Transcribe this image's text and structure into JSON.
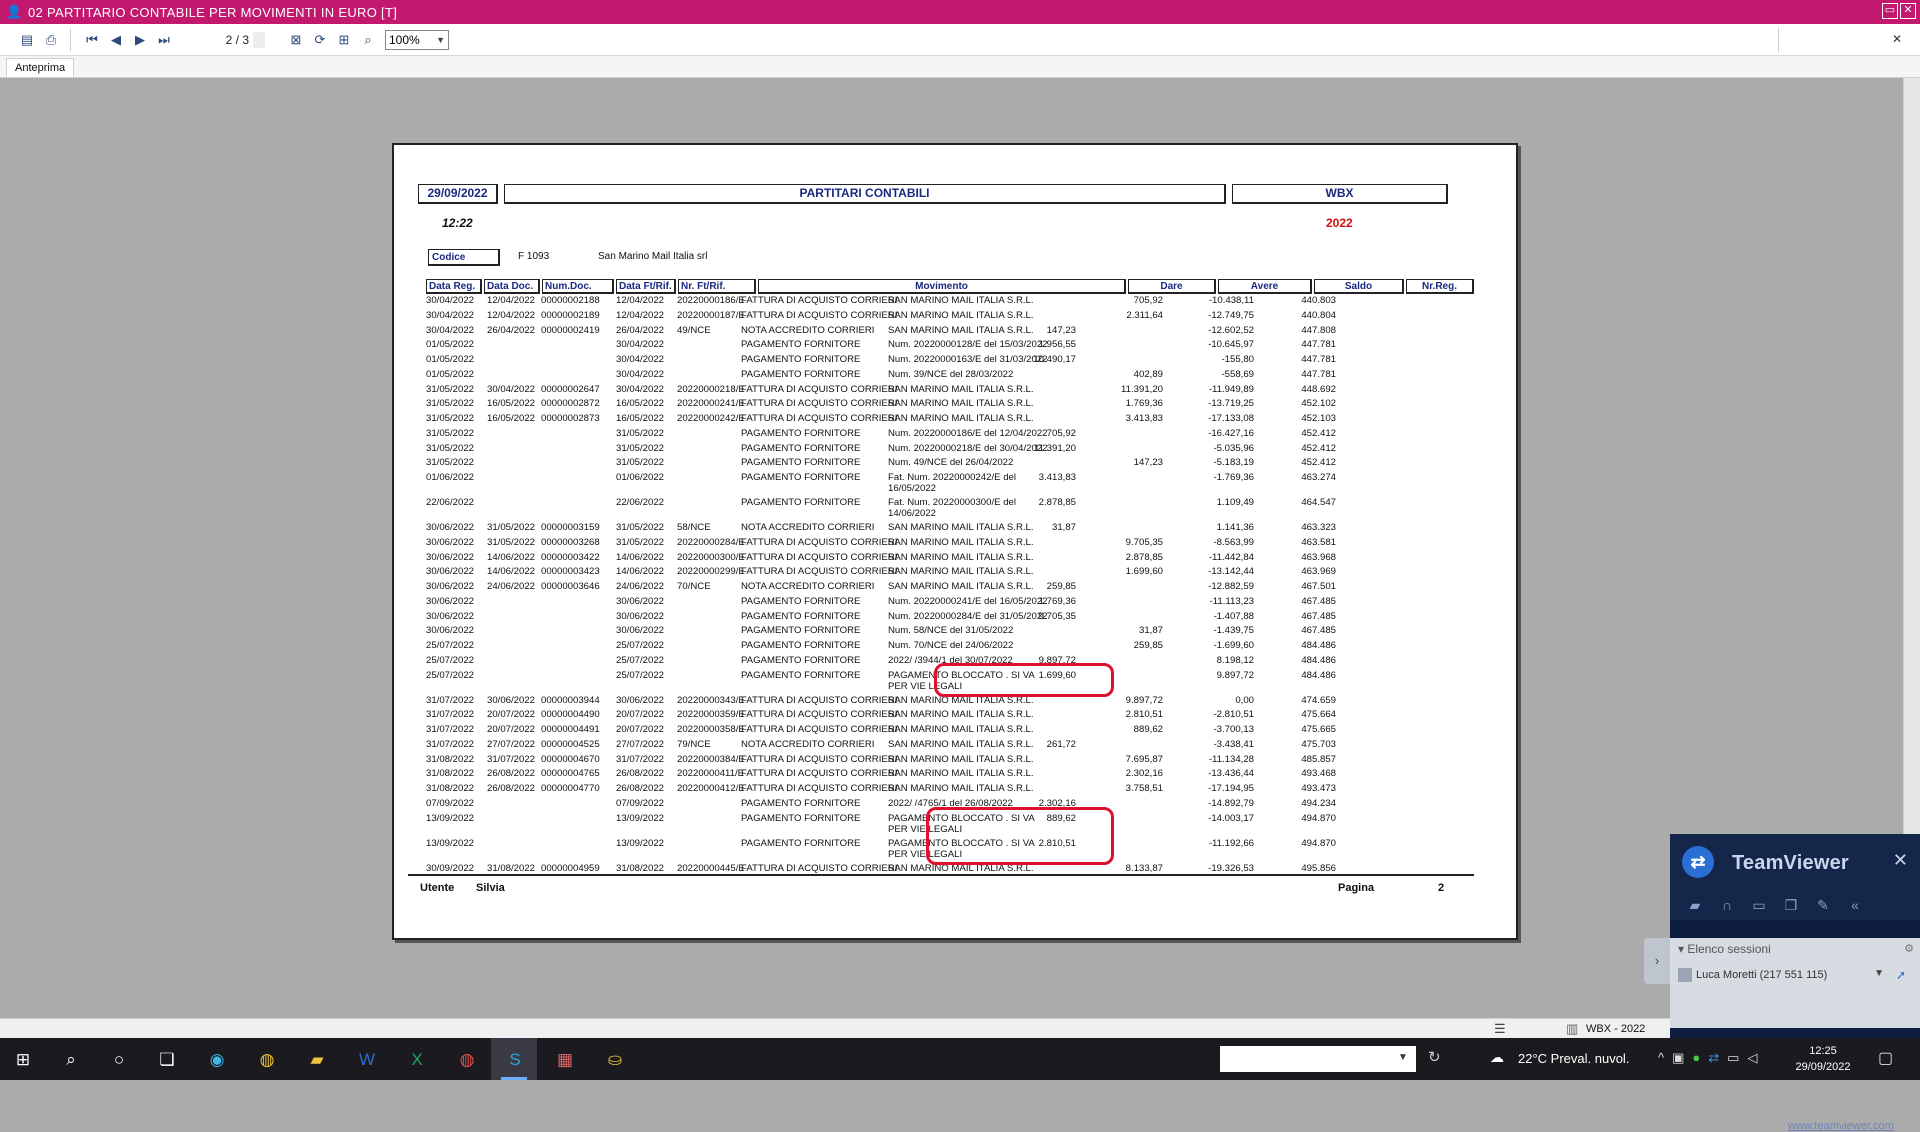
{
  "window": {
    "title": "02  PARTITARIO CONTABILE PER MOVIMENTI IN EURO [T]",
    "title_icon": "user-icon",
    "minimize": "▭",
    "close": "✕"
  },
  "toolbar": {
    "page_indicator": "2 / 3",
    "zoom": "100%",
    "icons": [
      "export-icon",
      "print-icon",
      "first-page-icon",
      "prev-page-icon",
      "next-page-icon",
      "last-page-icon",
      "close-preview-icon",
      "refresh-icon",
      "page-setup-icon",
      "find-icon"
    ],
    "close": "✕"
  },
  "tabs": {
    "preview": "Anteprima"
  },
  "report": {
    "date": "29/09/2022",
    "title": "PARTITARI CONTABILI",
    "company": "WBX",
    "time": "12:22",
    "year": "2022",
    "codice_label": "Codice",
    "codice_value": "F  1093",
    "codice_name": "San Marino Mail Italia srl",
    "columns": {
      "data_reg": "Data Reg.",
      "data_doc": "Data Doc.",
      "num_doc": "Num.Doc.",
      "data_ft": "Data Ft/Rif.",
      "nr_ft": "Nr. Ft/Rif.",
      "movimento": "Movimento",
      "dare": "Dare",
      "avere": "Avere",
      "saldo": "Saldo",
      "nr_reg": "Nr.Reg."
    },
    "rows": [
      {
        "dreg": "30/04/2022",
        "ddoc": "12/04/2022",
        "ndoc": "00000002188",
        "dft": "12/04/2022",
        "nft": "20220000186/E",
        "cau": "FATTURA DI ACQUISTO CORRIERI",
        "desc": "SAN MARINO MAIL ITALIA S.R.L.",
        "dare": "",
        "avere": "705,92",
        "saldo": "-10.438,11",
        "nreg": "440.803"
      },
      {
        "dreg": "30/04/2022",
        "ddoc": "12/04/2022",
        "ndoc": "00000002189",
        "dft": "12/04/2022",
        "nft": "20220000187/E",
        "cau": "FATTURA DI ACQUISTO CORRIERI",
        "desc": "SAN MARINO MAIL ITALIA S.R.L.",
        "dare": "",
        "avere": "2.311,64",
        "saldo": "-12.749,75",
        "nreg": "440.804"
      },
      {
        "dreg": "30/04/2022",
        "ddoc": "26/04/2022",
        "ndoc": "00000002419",
        "dft": "26/04/2022",
        "nft": "49/NCE",
        "cau": "NOTA ACCREDITO CORRIERI",
        "desc": "SAN MARINO MAIL ITALIA S.R.L.",
        "dare": "147,23",
        "avere": "",
        "saldo": "-12.602,52",
        "nreg": "447.808"
      },
      {
        "dreg": "01/05/2022",
        "ddoc": "",
        "ndoc": "",
        "dft": "30/04/2022",
        "nft": "",
        "cau": "PAGAMENTO FORNITORE",
        "desc": "Num. 20220000128/E del 15/03/2022",
        "dare": "1.956,55",
        "avere": "",
        "saldo": "-10.645,97",
        "nreg": "447.781"
      },
      {
        "dreg": "01/05/2022",
        "ddoc": "",
        "ndoc": "",
        "dft": "30/04/2022",
        "nft": "",
        "cau": "PAGAMENTO FORNITORE",
        "desc": "Num. 20220000163/E del 31/03/2022",
        "dare": "10.490,17",
        "avere": "",
        "saldo": "-155,80",
        "nreg": "447.781"
      },
      {
        "dreg": "01/05/2022",
        "ddoc": "",
        "ndoc": "",
        "dft": "30/04/2022",
        "nft": "",
        "cau": "PAGAMENTO FORNITORE",
        "desc": "Num. 39/NCE del 28/03/2022",
        "dare": "",
        "avere": "402,89",
        "saldo": "-558,69",
        "nreg": "447.781"
      },
      {
        "dreg": "31/05/2022",
        "ddoc": "30/04/2022",
        "ndoc": "00000002647",
        "dft": "30/04/2022",
        "nft": "20220000218/E",
        "cau": "FATTURA DI ACQUISTO CORRIERI",
        "desc": "SAN MARINO MAIL ITALIA S.R.L.",
        "dare": "",
        "avere": "11.391,20",
        "saldo": "-11.949,89",
        "nreg": "448.692"
      },
      {
        "dreg": "31/05/2022",
        "ddoc": "16/05/2022",
        "ndoc": "00000002872",
        "dft": "16/05/2022",
        "nft": "20220000241/E",
        "cau": "FATTURA DI ACQUISTO CORRIERI",
        "desc": "SAN MARINO MAIL ITALIA S.R.L.",
        "dare": "",
        "avere": "1.769,36",
        "saldo": "-13.719,25",
        "nreg": "452.102"
      },
      {
        "dreg": "31/05/2022",
        "ddoc": "16/05/2022",
        "ndoc": "00000002873",
        "dft": "16/05/2022",
        "nft": "20220000242/E",
        "cau": "FATTURA DI ACQUISTO CORRIERI",
        "desc": "SAN MARINO MAIL ITALIA S.R.L.",
        "dare": "",
        "avere": "3.413,83",
        "saldo": "-17.133,08",
        "nreg": "452.103"
      },
      {
        "dreg": "31/05/2022",
        "ddoc": "",
        "ndoc": "",
        "dft": "31/05/2022",
        "nft": "",
        "cau": "PAGAMENTO FORNITORE",
        "desc": "Num. 20220000186/E del 12/04/2022",
        "dare": "705,92",
        "avere": "",
        "saldo": "-16.427,16",
        "nreg": "452.412"
      },
      {
        "dreg": "31/05/2022",
        "ddoc": "",
        "ndoc": "",
        "dft": "31/05/2022",
        "nft": "",
        "cau": "PAGAMENTO FORNITORE",
        "desc": "Num. 20220000218/E del 30/04/2022",
        "dare": "11.391,20",
        "avere": "",
        "saldo": "-5.035,96",
        "nreg": "452.412"
      },
      {
        "dreg": "31/05/2022",
        "ddoc": "",
        "ndoc": "",
        "dft": "31/05/2022",
        "nft": "",
        "cau": "PAGAMENTO FORNITORE",
        "desc": "Num. 49/NCE del 26/04/2022",
        "dare": "",
        "avere": "147,23",
        "saldo": "-5.183,19",
        "nreg": "452.412"
      },
      {
        "dreg": "01/06/2022",
        "ddoc": "",
        "ndoc": "",
        "dft": "01/06/2022",
        "nft": "",
        "cau": "PAGAMENTO FORNITORE",
        "desc": "Fat. Num. 20220000242/E del 16/05/2022",
        "dare": "3.413,83",
        "avere": "",
        "saldo": "-1.769,36",
        "nreg": "463.274",
        "tall": true
      },
      {
        "dreg": "22/06/2022",
        "ddoc": "",
        "ndoc": "",
        "dft": "22/06/2022",
        "nft": "",
        "cau": "PAGAMENTO FORNITORE",
        "desc": "Fat. Num. 20220000300/E del 14/06/2022",
        "dare": "2.878,85",
        "avere": "",
        "saldo": "1.109,49",
        "nreg": "464.547",
        "tall": true
      },
      {
        "dreg": "30/06/2022",
        "ddoc": "31/05/2022",
        "ndoc": "00000003159",
        "dft": "31/05/2022",
        "nft": "58/NCE",
        "cau": "NOTA ACCREDITO CORRIERI",
        "desc": "SAN MARINO MAIL ITALIA S.R.L.",
        "dare": "31,87",
        "avere": "",
        "saldo": "1.141,36",
        "nreg": "463.323"
      },
      {
        "dreg": "30/06/2022",
        "ddoc": "31/05/2022",
        "ndoc": "00000003268",
        "dft": "31/05/2022",
        "nft": "20220000284/E",
        "cau": "FATTURA DI ACQUISTO CORRIERI",
        "desc": "SAN MARINO MAIL ITALIA S.R.L.",
        "dare": "",
        "avere": "9.705,35",
        "saldo": "-8.563,99",
        "nreg": "463.581"
      },
      {
        "dreg": "30/06/2022",
        "ddoc": "14/06/2022",
        "ndoc": "00000003422",
        "dft": "14/06/2022",
        "nft": "20220000300/E",
        "cau": "FATTURA DI ACQUISTO CORRIERI",
        "desc": "SAN MARINO MAIL ITALIA S.R.L.",
        "dare": "",
        "avere": "2.878,85",
        "saldo": "-11.442,84",
        "nreg": "463.968"
      },
      {
        "dreg": "30/06/2022",
        "ddoc": "14/06/2022",
        "ndoc": "00000003423",
        "dft": "14/06/2022",
        "nft": "20220000299/E",
        "cau": "FATTURA DI ACQUISTO CORRIERI",
        "desc": "SAN MARINO MAIL ITALIA S.R.L.",
        "dare": "",
        "avere": "1.699,60",
        "saldo": "-13.142,44",
        "nreg": "463.969"
      },
      {
        "dreg": "30/06/2022",
        "ddoc": "24/06/2022",
        "ndoc": "00000003646",
        "dft": "24/06/2022",
        "nft": "70/NCE",
        "cau": "NOTA ACCREDITO CORRIERI",
        "desc": "SAN MARINO MAIL ITALIA S.R.L.",
        "dare": "259,85",
        "avere": "",
        "saldo": "-12.882,59",
        "nreg": "467.501"
      },
      {
        "dreg": "30/06/2022",
        "ddoc": "",
        "ndoc": "",
        "dft": "30/06/2022",
        "nft": "",
        "cau": "PAGAMENTO FORNITORE",
        "desc": "Num. 20220000241/E del 16/05/2022",
        "dare": "1.769,36",
        "avere": "",
        "saldo": "-11.113,23",
        "nreg": "467.485"
      },
      {
        "dreg": "30/06/2022",
        "ddoc": "",
        "ndoc": "",
        "dft": "30/06/2022",
        "nft": "",
        "cau": "PAGAMENTO FORNITORE",
        "desc": "Num. 20220000284/E del 31/05/2022",
        "dare": "9.705,35",
        "avere": "",
        "saldo": "-1.407,88",
        "nreg": "467.485"
      },
      {
        "dreg": "30/06/2022",
        "ddoc": "",
        "ndoc": "",
        "dft": "30/06/2022",
        "nft": "",
        "cau": "PAGAMENTO FORNITORE",
        "desc": "Num. 58/NCE del 31/05/2022",
        "dare": "",
        "avere": "31,87",
        "saldo": "-1.439,75",
        "nreg": "467.485"
      },
      {
        "dreg": "25/07/2022",
        "ddoc": "",
        "ndoc": "",
        "dft": "25/07/2022",
        "nft": "",
        "cau": "PAGAMENTO FORNITORE",
        "desc": "Num. 70/NCE del 24/06/2022",
        "dare": "",
        "avere": "259,85",
        "saldo": "-1.699,60",
        "nreg": "484.486"
      },
      {
        "dreg": "25/07/2022",
        "ddoc": "",
        "ndoc": "",
        "dft": "25/07/2022",
        "nft": "",
        "cau": "PAGAMENTO FORNITORE",
        "desc": "2022/     /3944/1 del 30/07/2022",
        "dare": "9.897,72",
        "avere": "",
        "saldo": "8.198,12",
        "nreg": "484.486"
      },
      {
        "dreg": "25/07/2022",
        "ddoc": "",
        "ndoc": "",
        "dft": "25/07/2022",
        "nft": "",
        "cau": "PAGAMENTO FORNITORE",
        "desc": "PAGAMENTO BLOCCATO . SI VA PER VIE LEGALI",
        "dare": "1.699,60",
        "avere": "",
        "saldo": "9.897,72",
        "nreg": "484.486",
        "tall": true
      },
      {
        "dreg": "31/07/2022",
        "ddoc": "30/06/2022",
        "ndoc": "00000003944",
        "dft": "30/06/2022",
        "nft": "20220000343/E",
        "cau": "FATTURA DI ACQUISTO CORRIERI",
        "desc": "SAN MARINO MAIL ITALIA S.R.L.",
        "dare": "",
        "avere": "9.897,72",
        "saldo": "0,00",
        "nreg": "474.659"
      },
      {
        "dreg": "31/07/2022",
        "ddoc": "20/07/2022",
        "ndoc": "00000004490",
        "dft": "20/07/2022",
        "nft": "20220000359/E",
        "cau": "FATTURA DI ACQUISTO CORRIERI",
        "desc": "SAN MARINO MAIL ITALIA S.R.L.",
        "dare": "",
        "avere": "2.810,51",
        "saldo": "-2.810,51",
        "nreg": "475.664"
      },
      {
        "dreg": "31/07/2022",
        "ddoc": "20/07/2022",
        "ndoc": "00000004491",
        "dft": "20/07/2022",
        "nft": "20220000358/E",
        "cau": "FATTURA DI ACQUISTO CORRIERI",
        "desc": "SAN MARINO MAIL ITALIA S.R.L.",
        "dare": "",
        "avere": "889,62",
        "saldo": "-3.700,13",
        "nreg": "475.665"
      },
      {
        "dreg": "31/07/2022",
        "ddoc": "27/07/2022",
        "ndoc": "00000004525",
        "dft": "27/07/2022",
        "nft": "79/NCE",
        "cau": "NOTA ACCREDITO CORRIERI",
        "desc": "SAN MARINO MAIL ITALIA S.R.L.",
        "dare": "261,72",
        "avere": "",
        "saldo": "-3.438,41",
        "nreg": "475.703"
      },
      {
        "dreg": "31/08/2022",
        "ddoc": "31/07/2022",
        "ndoc": "00000004670",
        "dft": "31/07/2022",
        "nft": "20220000384/E",
        "cau": "FATTURA DI ACQUISTO CORRIERI",
        "desc": "SAN MARINO MAIL ITALIA S.R.L.",
        "dare": "",
        "avere": "7.695,87",
        "saldo": "-11.134,28",
        "nreg": "485.857"
      },
      {
        "dreg": "31/08/2022",
        "ddoc": "26/08/2022",
        "ndoc": "00000004765",
        "dft": "26/08/2022",
        "nft": "20220000411/E",
        "cau": "FATTURA DI ACQUISTO CORRIERI",
        "desc": "SAN MARINO MAIL ITALIA S.R.L.",
        "dare": "",
        "avere": "2.302,16",
        "saldo": "-13.436,44",
        "nreg": "493.468"
      },
      {
        "dreg": "31/08/2022",
        "ddoc": "26/08/2022",
        "ndoc": "00000004770",
        "dft": "26/08/2022",
        "nft": "20220000412/E",
        "cau": "FATTURA DI ACQUISTO CORRIERI",
        "desc": "SAN MARINO MAIL ITALIA S.R.L.",
        "dare": "",
        "avere": "3.758,51",
        "saldo": "-17.194,95",
        "nreg": "493.473"
      },
      {
        "dreg": "07/09/2022",
        "ddoc": "",
        "ndoc": "",
        "dft": "07/09/2022",
        "nft": "",
        "cau": "PAGAMENTO FORNITORE",
        "desc": "2022/     /4765/1 del 26/08/2022",
        "dare": "2.302,16",
        "avere": "",
        "saldo": "-14.892,79",
        "nreg": "494.234"
      },
      {
        "dreg": "13/09/2022",
        "ddoc": "",
        "ndoc": "",
        "dft": "13/09/2022",
        "nft": "",
        "cau": "PAGAMENTO FORNITORE",
        "desc": "PAGAMENTO BLOCCATO . SI VA PER VIE LEGALI",
        "dare": "889,62",
        "avere": "",
        "saldo": "-14.003,17",
        "nreg": "494.870",
        "tall": true
      },
      {
        "dreg": "13/09/2022",
        "ddoc": "",
        "ndoc": "",
        "dft": "13/09/2022",
        "nft": "",
        "cau": "PAGAMENTO FORNITORE",
        "desc": "PAGAMENTO BLOCCATO . SI VA PER VIE LEGALI",
        "dare": "2.810,51",
        "avere": "",
        "saldo": "-11.192,66",
        "nreg": "494.870",
        "tall": true
      },
      {
        "dreg": "30/09/2022",
        "ddoc": "31/08/2022",
        "ndoc": "00000004959",
        "dft": "31/08/2022",
        "nft": "20220000445/E",
        "cau": "FATTURA DI ACQUISTO CORRIERI",
        "desc": "SAN MARINO MAIL ITALIA S.R.L.",
        "dare": "",
        "avere": "8.133,87",
        "saldo": "-19.326,53",
        "nreg": "495.856"
      }
    ],
    "footer": {
      "utente_label": "Utente",
      "utente_value": "Silvia",
      "pagina_label": "Pagina",
      "pagina_value": "2"
    },
    "annotation_color": "#e0102a"
  },
  "statusbar": {
    "company": "WBX - 2022"
  },
  "teamviewer": {
    "title": "TeamViewer",
    "sessions_label": "Elenco sessioni",
    "session_user": "Luca Moretti (217 551 115)",
    "link": "www.teamviewer.com"
  },
  "taskbar": {
    "weather": "22°C  Preval. nuvol.",
    "time": "12:25",
    "date": "29/09/2022"
  }
}
